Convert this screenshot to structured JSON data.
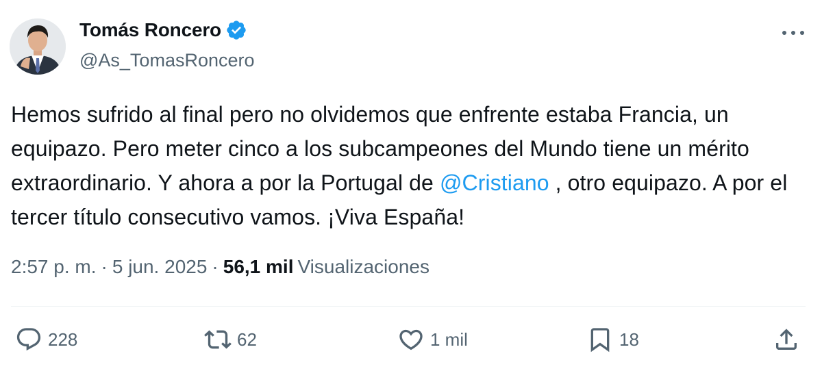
{
  "author": {
    "name": "Tomás Roncero",
    "handle": "@As_TomasRoncero",
    "verified": true
  },
  "tweet": {
    "text_before": "Hemos sufrido al final pero no olvidemos que enfrente estaba Francia, un equipazo. Pero meter cinco a los subcampeones del Mundo tiene un mérito extraordinario. Y ahora a por la Portugal de ",
    "mention": "@Cristiano",
    "text_after": " , otro equipazo. A por el tercer título consecutivo vamos. ¡Viva España!"
  },
  "meta": {
    "time": "2:57 p. m.",
    "separator": "·",
    "date": "5 jun. 2025",
    "views_count": "56,1 mil",
    "views_label": "Visualizaciones"
  },
  "actions": {
    "replies": "228",
    "retweets": "62",
    "likes": "1 mil",
    "bookmarks": "18"
  },
  "colors": {
    "accent": "#1d9bf0",
    "text": "#0f1419",
    "muted": "#536471"
  },
  "icons": [
    "verified-badge-icon",
    "more-options-icon",
    "reply-icon",
    "retweet-icon",
    "like-icon",
    "bookmark-icon",
    "share-icon"
  ]
}
